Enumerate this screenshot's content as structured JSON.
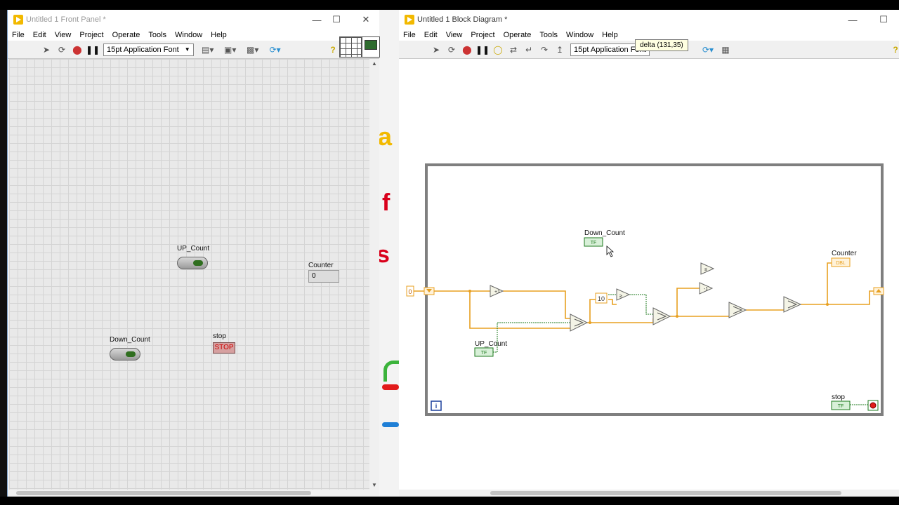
{
  "front_panel": {
    "title": "Untitled 1 Front Panel *",
    "menu": [
      "File",
      "Edit",
      "View",
      "Project",
      "Operate",
      "Tools",
      "Window",
      "Help"
    ],
    "font_selector": "15pt Application Font",
    "controls": {
      "up_count_label": "UP_Count",
      "down_count_label": "Down_Count",
      "counter_label": "Counter",
      "counter_value": "0",
      "stop_label": "stop",
      "stop_button_text": "STOP"
    }
  },
  "block_diagram": {
    "title": "Untitled 1 Block Diagram *",
    "menu": [
      "File",
      "Edit",
      "View",
      "Project",
      "Operate",
      "Tools",
      "Window",
      "Help"
    ],
    "font_selector": "15pt Application Font",
    "tooltip": "delta (131,35)",
    "labels": {
      "down_count": "Down_Count",
      "up_count": "UP_Count",
      "counter": "Counter",
      "stop": "stop"
    },
    "terminals": {
      "bool": "TF",
      "dbl": "DBL",
      "init_const": "0",
      "limit_const": "10",
      "iteration": "i",
      "increment": "+1",
      "decrement": "-1"
    }
  },
  "colors": {
    "orange_wire": "#e8a020",
    "green_wire": "#1d7a1d",
    "loop_border": "#7f7f7f",
    "brand": "#f2b900"
  }
}
